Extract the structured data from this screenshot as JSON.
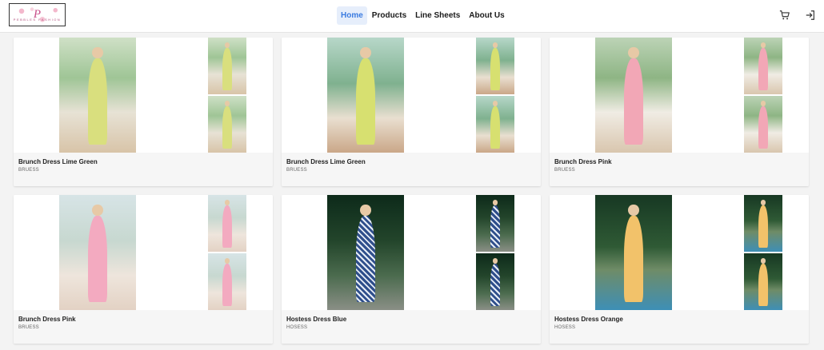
{
  "header": {
    "logo": {
      "mark": "P",
      "wordmark": "PEBBLES FASHION"
    },
    "nav": [
      {
        "label": "Home",
        "active": true
      },
      {
        "label": "Products",
        "active": false
      },
      {
        "label": "Line Sheets",
        "active": false
      },
      {
        "label": "About Us",
        "active": false
      }
    ],
    "icons": [
      "cart-icon",
      "logout-icon"
    ]
  },
  "products": [
    {
      "title": "Brunch Dress Lime Green",
      "sku": "BRUESS",
      "photo": "p-lime"
    },
    {
      "title": "Brunch Dress Lime Green",
      "sku": "BRUESS",
      "photo": "p-lime2"
    },
    {
      "title": "Brunch Dress Pink",
      "sku": "BRUESS",
      "photo": "p-pink"
    },
    {
      "title": "Brunch Dress Pink",
      "sku": "BRUESS",
      "photo": "p-pink2"
    },
    {
      "title": "Hostess Dress Blue",
      "sku": "HOSESS",
      "photo": "p-blue"
    },
    {
      "title": "Hostess Dress Orange",
      "sku": "HOSESS",
      "photo": "p-orange"
    }
  ],
  "colors": {
    "nav_active_bg": "#e6eefb",
    "nav_active_text": "#3a7be0",
    "card_info_bg": "#f6f6f6"
  }
}
